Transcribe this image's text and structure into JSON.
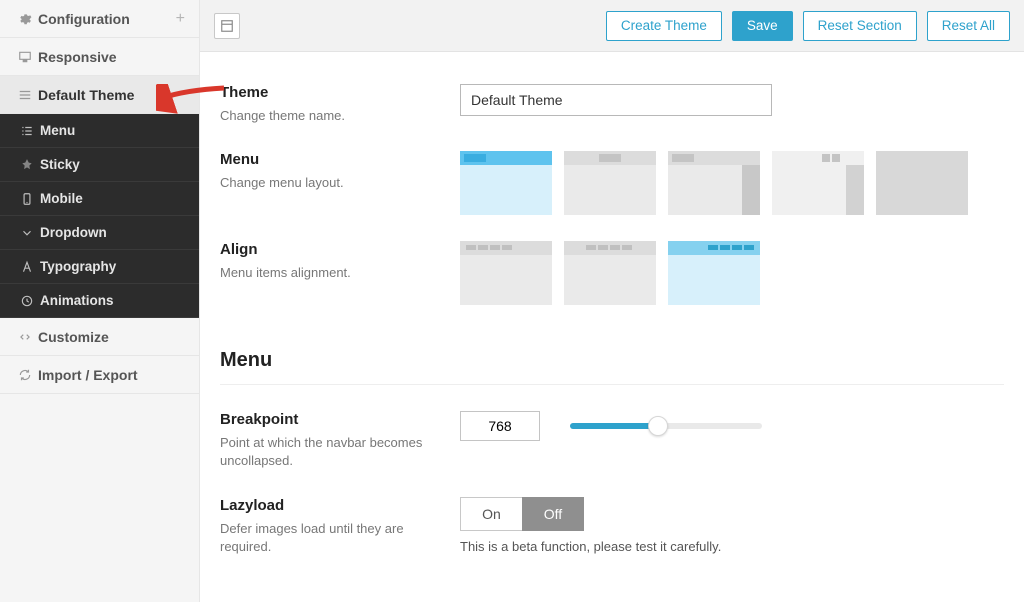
{
  "topbar": {
    "create_theme": "Create Theme",
    "save": "Save",
    "reset_section": "Reset Section",
    "reset_all": "Reset All"
  },
  "sidebar": {
    "configuration": "Configuration",
    "responsive": "Responsive",
    "default_theme": "Default Theme",
    "customize": "Customize",
    "import_export": "Import / Export",
    "sub": {
      "menu": "Menu",
      "sticky": "Sticky",
      "mobile": "Mobile",
      "dropdown": "Dropdown",
      "typography": "Typography",
      "animations": "Animations"
    }
  },
  "fields": {
    "theme": {
      "label": "Theme",
      "desc": "Change theme name.",
      "value": "Default Theme"
    },
    "menu": {
      "label": "Menu",
      "desc": "Change menu layout."
    },
    "align": {
      "label": "Align",
      "desc": "Menu items alignment."
    },
    "section_menu": "Menu",
    "breakpoint": {
      "label": "Breakpoint",
      "desc": "Point at which the navbar becomes uncollapsed.",
      "value": "768"
    },
    "lazyload": {
      "label": "Lazyload",
      "desc": "Defer images load until they are required.",
      "on": "On",
      "off": "Off",
      "hint": "This is a beta function, please test it carefully."
    }
  }
}
